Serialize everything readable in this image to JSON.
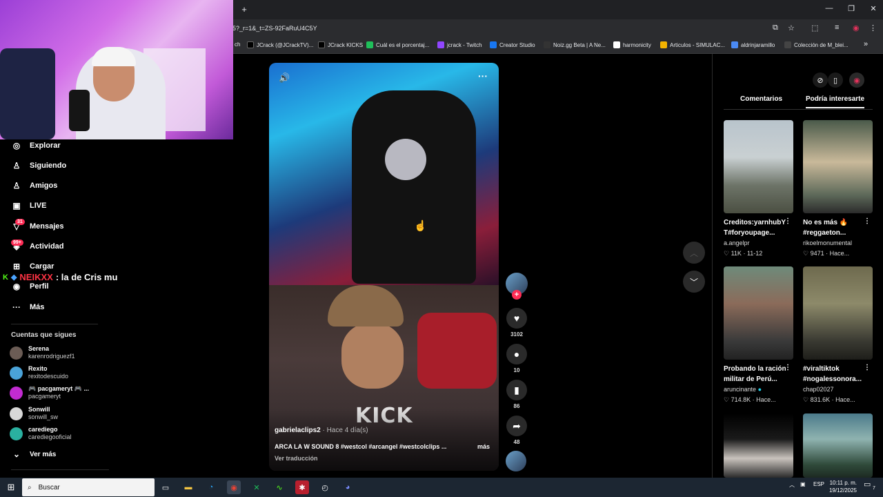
{
  "browser": {
    "url": "5?_r=1&_t=ZS-92FaRuU4C5Y",
    "bookmarks": [
      {
        "label": "ch",
        "color": "#000000"
      },
      {
        "label": "JCrack (@JCrackTV)...",
        "color": "#000000"
      },
      {
        "label": "JCrack KICKS",
        "color": "#000000"
      },
      {
        "label": "Cuál es el porcentaj...",
        "color": "#1fbf5a"
      },
      {
        "label": "jcrack - Twitch",
        "color": "#9146ff"
      },
      {
        "label": "Creator Studio",
        "color": "#1877f2"
      },
      {
        "label": "Noiz.gg Beta | A Ne...",
        "color": "#333333"
      },
      {
        "label": "harmonicity",
        "color": "#ffffff"
      },
      {
        "label": "Articulos - SIMULAC...",
        "color": "#f4b400"
      },
      {
        "label": "aldrinjaramillo",
        "color": "#4a8af4"
      },
      {
        "label": "Colección de M_blei...",
        "color": "#444444"
      }
    ],
    "overflow": "»"
  },
  "sidebar": {
    "items": [
      {
        "label": "Explorar",
        "icon": "compass-icon",
        "glyph": "◎"
      },
      {
        "label": "Siguiendo",
        "icon": "following-icon",
        "glyph": "♙"
      },
      {
        "label": "Amigos",
        "icon": "friends-icon",
        "glyph": "♙"
      },
      {
        "label": "LIVE",
        "icon": "live-icon",
        "glyph": "▣"
      },
      {
        "label": "Mensajes",
        "icon": "messages-icon",
        "glyph": "▽",
        "badge": "31"
      },
      {
        "label": "Actividad",
        "icon": "activity-icon",
        "glyph": "◈",
        "badge": "99+"
      },
      {
        "label": "Cargar",
        "icon": "upload-icon",
        "glyph": "⊞"
      },
      {
        "label": "Perfil",
        "icon": "profile-icon",
        "glyph": "◉"
      },
      {
        "label": "Más",
        "icon": "more-icon",
        "glyph": "···"
      }
    ],
    "following_title": "Cuentas que sigues",
    "accounts": [
      {
        "name": "Serena",
        "handle": "karenrodriguezf1",
        "color": "#6b5c55"
      },
      {
        "name": "Rexito",
        "handle": "rexitodescuido",
        "color": "#4aa3d8"
      },
      {
        "name": "🎮 pacgameryt 🎮 ...",
        "handle": "pacgameryt",
        "color": "#c22bd1"
      },
      {
        "name": "Sonwill",
        "handle": "sonwill_sw",
        "color": "#d8d8d8"
      },
      {
        "name": "carediego",
        "handle": "carediegooficial",
        "color": "#2ab0a0"
      }
    ],
    "see_more": "Ver más"
  },
  "chat_overlay": {
    "user": "NEIKXX",
    "message": ": la de Cris mu"
  },
  "video": {
    "author": "gabrielaclips2",
    "ago": " · Hace 4 día(s)",
    "description": "ARCA LA W SOUND 8 #westcol #arcangel #westcolclips ...",
    "more": "más",
    "translate": "Ver traducción",
    "watermark": "KICK",
    "likes": "3102",
    "comments": "10",
    "saves": "86",
    "shares": "48"
  },
  "right_panel": {
    "tabs": [
      "Comentarios",
      "Podría interesarte"
    ],
    "cards": [
      {
        "title": "Creditos:yarnhubY T#foryoupage...",
        "author": "a.angelpr",
        "verified": false,
        "likes": "11K",
        "date": "11-12",
        "thumb": "linear-gradient(180deg,#b9c4cc,#c9d0d2 40%,#6d7468 70%,#4b4f42)"
      },
      {
        "title": "No es más 🔥 #reggaeton...",
        "author": "rikoelmonumental",
        "verified": false,
        "likes": "9471",
        "date": "Hace...",
        "thumb": "linear-gradient(180deg,#4a5a4a,#c9b99a 45%,#5e6a5a 80%,#2b2b2b)"
      },
      {
        "title": "Probando la ración militar de Perú...",
        "author": "aruncinante",
        "verified": true,
        "likes": "714.8K",
        "date": "Hace...",
        "thumb": "linear-gradient(180deg,#6e8a7a,#8b6b5a 40%,#3a3a3a 80%,#222)"
      },
      {
        "title": "#viraltiktok #nogalessonora...",
        "author": "chap02027",
        "verified": false,
        "likes": "831.6K",
        "date": "Hace...",
        "thumb": "linear-gradient(180deg,#6e6a4e,#8d8a6a 40%,#3a3a32 80%,#1e1e1a)"
      },
      {
        "title": "",
        "author": "",
        "verified": false,
        "likes": "",
        "date": "",
        "thumb": "linear-gradient(180deg,#000,#1a1a1a 40%,#c9c3bd 70%,#2b2b2b)"
      },
      {
        "title": "",
        "author": "",
        "verified": false,
        "likes": "",
        "date": "",
        "thumb": "linear-gradient(180deg,#4b7a8a,#8fb3b0 40%,#2f4a3a 80%,#1d2a22)"
      }
    ]
  },
  "taskbar": {
    "search_placeholder": "Buscar",
    "lang": "ESP",
    "time": "10:11 p. m.",
    "date": "19/12/2025",
    "notif_count": "7"
  }
}
